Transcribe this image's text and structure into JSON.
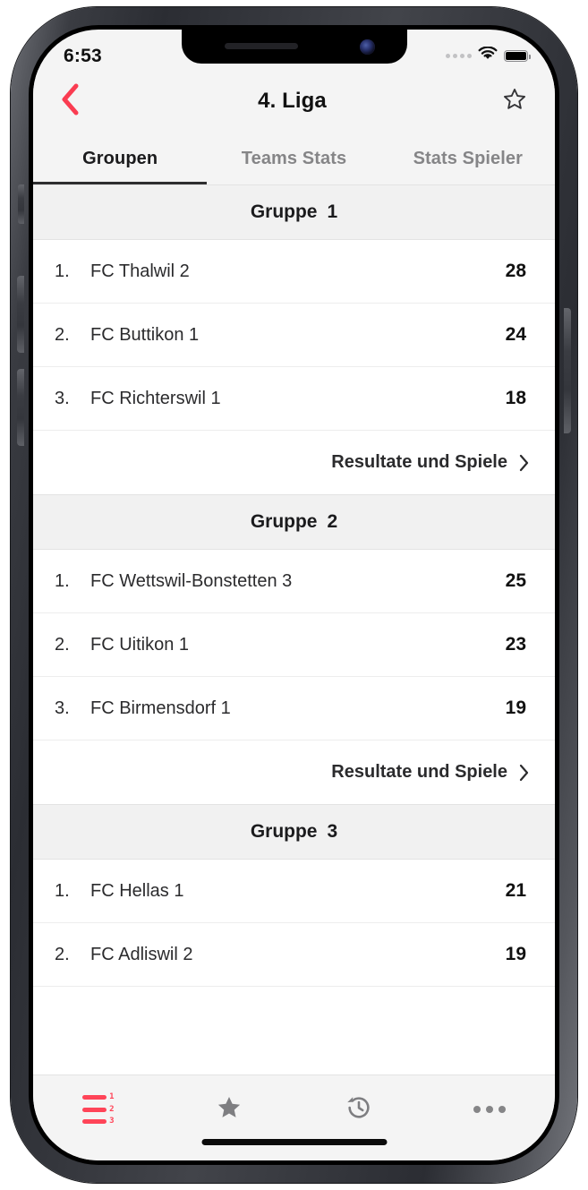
{
  "status_bar": {
    "time": "6:53",
    "signal_icon": "signal-dots-icon",
    "wifi_icon": "wifi-icon",
    "battery_icon": "battery-full-icon"
  },
  "nav": {
    "back_icon": "chevron-left-icon",
    "title": "4. Liga",
    "favorite_icon": "star-outline-icon"
  },
  "tabs": [
    {
      "label": "Groupen",
      "active": true
    },
    {
      "label": "Teams Stats",
      "active": false
    },
    {
      "label": "Stats Spieler",
      "active": false
    }
  ],
  "groups": [
    {
      "header_label": "Gruppe",
      "header_number": "1",
      "teams": [
        {
          "rank": "1.",
          "name": "FC Thalwil 2",
          "points": "28"
        },
        {
          "rank": "2.",
          "name": "FC Buttikon 1",
          "points": "24"
        },
        {
          "rank": "3.",
          "name": "FC Richterswil 1",
          "points": "18"
        }
      ],
      "results_label": "Resultate und Spiele",
      "results_chevron_icon": "chevron-right-icon"
    },
    {
      "header_label": "Gruppe",
      "header_number": "2",
      "teams": [
        {
          "rank": "1.",
          "name": "FC Wettswil-Bonstetten 3",
          "points": "25"
        },
        {
          "rank": "2.",
          "name": "FC Uitikon 1",
          "points": "23"
        },
        {
          "rank": "3.",
          "name": "FC Birmensdorf 1",
          "points": "19"
        }
      ],
      "results_label": "Resultate und Spiele",
      "results_chevron_icon": "chevron-right-icon"
    },
    {
      "header_label": "Gruppe",
      "header_number": "3",
      "teams": [
        {
          "rank": "1.",
          "name": "FC Hellas 1",
          "points": "21"
        },
        {
          "rank": "2.",
          "name": "FC Adliswil 2",
          "points": "19"
        }
      ],
      "results_label": "",
      "results_chevron_icon": ""
    }
  ],
  "bottom_bar": [
    {
      "icon": "rankings-icon",
      "active": true
    },
    {
      "icon": "star-filled-icon",
      "active": false
    },
    {
      "icon": "history-icon",
      "active": false
    },
    {
      "icon": "more-ellipsis-icon",
      "active": false
    }
  ],
  "colors": {
    "accent": "#ff4458",
    "active_tab_text": "#1b1b1d",
    "inactive_tab_text": "#858587",
    "group_header_bg": "#f1f1f1",
    "screen_bg": "#f4f4f4",
    "row_bg": "#ffffff"
  }
}
